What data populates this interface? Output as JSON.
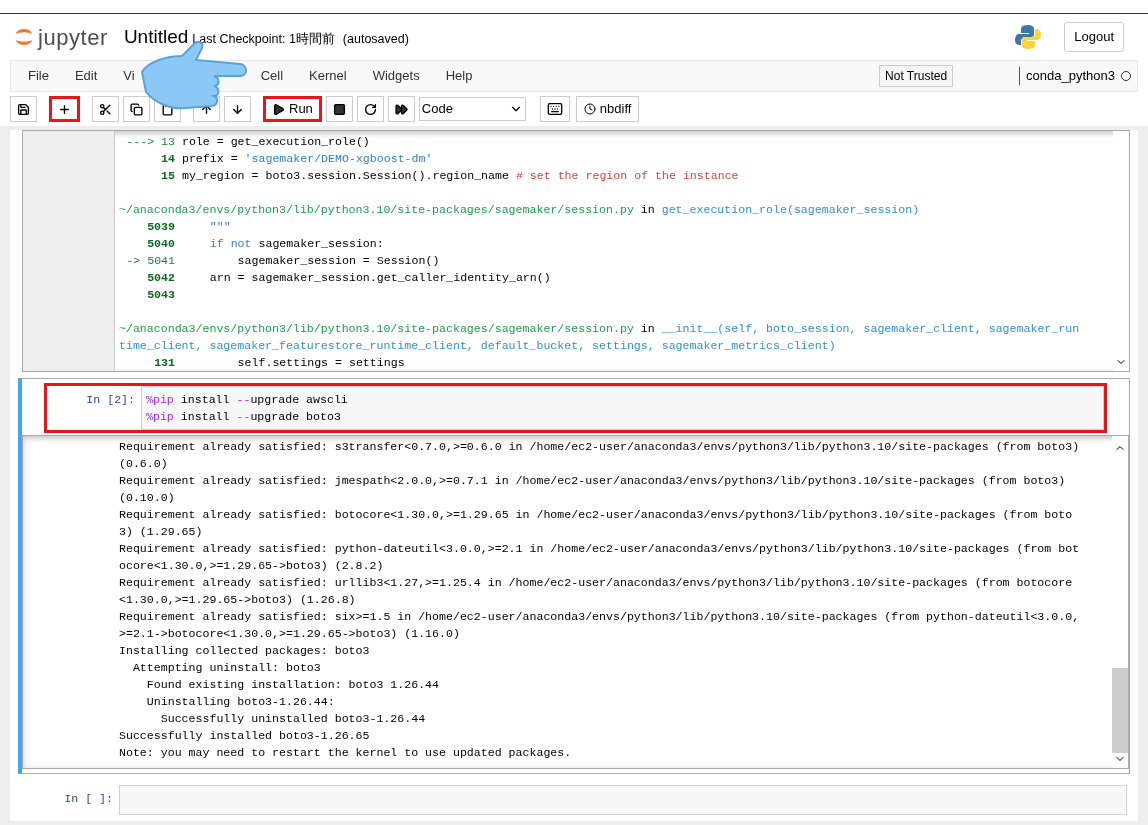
{
  "header": {
    "logo_text": "jupyter",
    "title": "Untitled",
    "checkpoint": "Last Checkpoint: 1時間前",
    "autosave": "(autosaved)",
    "logout": "Logout"
  },
  "menu": [
    {
      "label": "File"
    },
    {
      "label": "Edit"
    },
    {
      "label": "Vi"
    },
    {
      "label": "Cell"
    },
    {
      "label": "Kernel"
    },
    {
      "label": "Widgets"
    },
    {
      "label": "Help"
    }
  ],
  "trust": "Not Trusted",
  "kernel": {
    "name": "conda_python3",
    "busy": false
  },
  "toolbar": [
    {
      "kind": "save",
      "highlighted": false
    },
    {
      "kind": "add",
      "highlighted": true
    },
    {
      "kind": "cut",
      "highlighted": false
    },
    {
      "kind": "copy",
      "highlighted": false
    },
    {
      "kind": "paste",
      "highlighted": false
    },
    {
      "kind": "up",
      "highlighted": false
    },
    {
      "kind": "down",
      "highlighted": false
    },
    {
      "kind": "run",
      "label": "Run",
      "highlighted": true
    },
    {
      "kind": "stop",
      "highlighted": false
    },
    {
      "kind": "restart",
      "highlighted": false
    },
    {
      "kind": "runall",
      "highlighted": false
    }
  ],
  "cell_type": "Code",
  "nbdiff": "nbdiff",
  "cells": [
    {
      "kind": "traceback",
      "selected": false,
      "output_lines": [
        {
          "segments": [
            {
              "kind": "marker",
              "t": "---> 13"
            },
            {
              "kind": "text",
              "t": " role = get_execution_role()"
            }
          ]
        },
        {
          "segments": [
            {
              "kind": "lineno",
              "t": "14"
            },
            {
              "kind": "text",
              "t": " prefix = "
            },
            {
              "kind": "string",
              "t": "'sagemaker/DEMO-xgboost-dm'"
            }
          ]
        },
        {
          "segments": [
            {
              "kind": "lineno",
              "t": "15"
            },
            {
              "kind": "text",
              "t": " my_region = boto3.session.Session().region_name "
            },
            {
              "kind": "comment",
              "t": "# set the region of the instance"
            }
          ]
        },
        {
          "spaced": true,
          "segments": [
            {
              "kind": "path",
              "t": "~/anaconda3/envs/python3/lib/python3.10/site-packages/sagemaker/session.py"
            },
            {
              "kind": "text",
              "t": " in "
            },
            {
              "kind": "name",
              "t": "get_execution_role(sagemaker_session)"
            }
          ]
        },
        {
          "segments": [
            {
              "kind": "lineno",
              "t": "5039"
            },
            {
              "kind": "string",
              "t": "     \"\"\""
            }
          ]
        },
        {
          "segments": [
            {
              "kind": "lineno",
              "t": "5040"
            },
            {
              "kind": "keyword",
              "t": "     if not"
            },
            {
              "kind": "text",
              "t": " sagemaker_session:"
            }
          ]
        },
        {
          "segments": [
            {
              "kind": "marker",
              "t": "-> 5041"
            },
            {
              "kind": "text",
              "t": "         sagemaker_session = Session()"
            }
          ]
        },
        {
          "segments": [
            {
              "kind": "lineno",
              "t": "5042"
            },
            {
              "kind": "text",
              "t": "     arn = sagemaker_session.get_caller_identity_arn()"
            }
          ]
        },
        {
          "segments": [
            {
              "kind": "lineno",
              "t": "5043"
            }
          ]
        },
        {
          "spaced": true,
          "segments": [
            {
              "kind": "path",
              "t": "~/anaconda3/envs/python3/lib/python3.10/site-packages/sagemaker/session.py"
            },
            {
              "kind": "text",
              "t": " in "
            },
            {
              "kind": "name",
              "t": "__init__(self, boto_session, sagemaker_client, sagemaker_run"
            }
          ]
        },
        {
          "segments": [
            {
              "kind": "name",
              "t": "time_client, sagemaker_featurestore_runtime_client, default_bucket, settings, sagemaker_metrics_client)"
            }
          ]
        },
        {
          "segments": [
            {
              "kind": "lineno",
              "t": "131"
            },
            {
              "kind": "text",
              "t": "         self.settings = settings"
            }
          ]
        }
      ]
    },
    {
      "kind": "code",
      "prompt": "In [2]:",
      "selected": true,
      "highlighted": true,
      "input": [
        {
          "segments": [
            {
              "kind": "magic",
              "t": "%pip"
            },
            {
              "kind": "text",
              "t": " install "
            },
            {
              "kind": "magic",
              "t": "--"
            },
            {
              "kind": "text",
              "t": "upgrade awscli"
            }
          ]
        },
        {
          "segments": [
            {
              "kind": "magic",
              "t": "%pip"
            },
            {
              "kind": "text",
              "t": " install "
            },
            {
              "kind": "magic",
              "t": "--"
            },
            {
              "kind": "text",
              "t": "upgrade boto3"
            }
          ]
        }
      ],
      "output_lines": [
        {
          "segments": [
            {
              "kind": "text",
              "t": "Requirement already satisfied: s3transfer<0.7.0,>=0.6.0 in /home/ec2-user/anaconda3/envs/python3/lib/python3.10/site-packages (from boto3)"
            }
          ]
        },
        {
          "segments": [
            {
              "kind": "text",
              "t": "(0.6.0)"
            }
          ]
        },
        {
          "segments": [
            {
              "kind": "text",
              "t": "Requirement already satisfied: jmespath<2.0.0,>=0.7.1 in /home/ec2-user/anaconda3/envs/python3/lib/python3.10/site-packages (from boto3)"
            }
          ]
        },
        {
          "segments": [
            {
              "kind": "text",
              "t": "(0.10.0)"
            }
          ]
        },
        {
          "segments": [
            {
              "kind": "text",
              "t": "Requirement already satisfied: botocore<1.30.0,>=1.29.65 in /home/ec2-user/anaconda3/envs/python3/lib/python3.10/site-packages (from boto"
            }
          ]
        },
        {
          "segments": [
            {
              "kind": "text",
              "t": "3) (1.29.65)"
            }
          ]
        },
        {
          "segments": [
            {
              "kind": "text",
              "t": "Requirement already satisfied: python-dateutil<3.0.0,>=2.1 in /home/ec2-user/anaconda3/envs/python3/lib/python3.10/site-packages (from bot"
            }
          ]
        },
        {
          "segments": [
            {
              "kind": "text",
              "t": "ocore<1.30.0,>=1.29.65->boto3) (2.8.2)"
            }
          ]
        },
        {
          "segments": [
            {
              "kind": "text",
              "t": "Requirement already satisfied: urllib3<1.27,>=1.25.4 in /home/ec2-user/anaconda3/envs/python3/lib/python3.10/site-packages (from botocore"
            }
          ]
        },
        {
          "segments": [
            {
              "kind": "text",
              "t": "<1.30.0,>=1.29.65->boto3) (1.26.8)"
            }
          ]
        },
        {
          "segments": [
            {
              "kind": "text",
              "t": "Requirement already satisfied: six>=1.5 in /home/ec2-user/anaconda3/envs/python3/lib/python3.10/site-packages (from python-dateutil<3.0.0,"
            }
          ]
        },
        {
          "segments": [
            {
              "kind": "text",
              "t": ">=2.1->botocore<1.30.0,>=1.29.65->boto3) (1.16.0)"
            }
          ]
        },
        {
          "segments": [
            {
              "kind": "text",
              "t": "Installing collected packages: boto3"
            }
          ]
        },
        {
          "segments": [
            {
              "kind": "text",
              "t": "  Attempting uninstall: boto3"
            }
          ]
        },
        {
          "segments": [
            {
              "kind": "text",
              "t": "    Found existing installation: boto3 1.26.44"
            }
          ]
        },
        {
          "segments": [
            {
              "kind": "text",
              "t": "    Uninstalling boto3-1.26.44:"
            }
          ]
        },
        {
          "segments": [
            {
              "kind": "text",
              "t": "      Successfully uninstalled boto3-1.26.44"
            }
          ]
        },
        {
          "segments": [
            {
              "kind": "text",
              "t": "Successfully installed boto3-1.26.65"
            }
          ]
        },
        {
          "segments": [
            {
              "kind": "text",
              "t": "Note: you may need to restart the kernel to use updated packages."
            }
          ]
        }
      ]
    },
    {
      "kind": "code",
      "prompt": "In [ ]:",
      "selected": false
    }
  ]
}
